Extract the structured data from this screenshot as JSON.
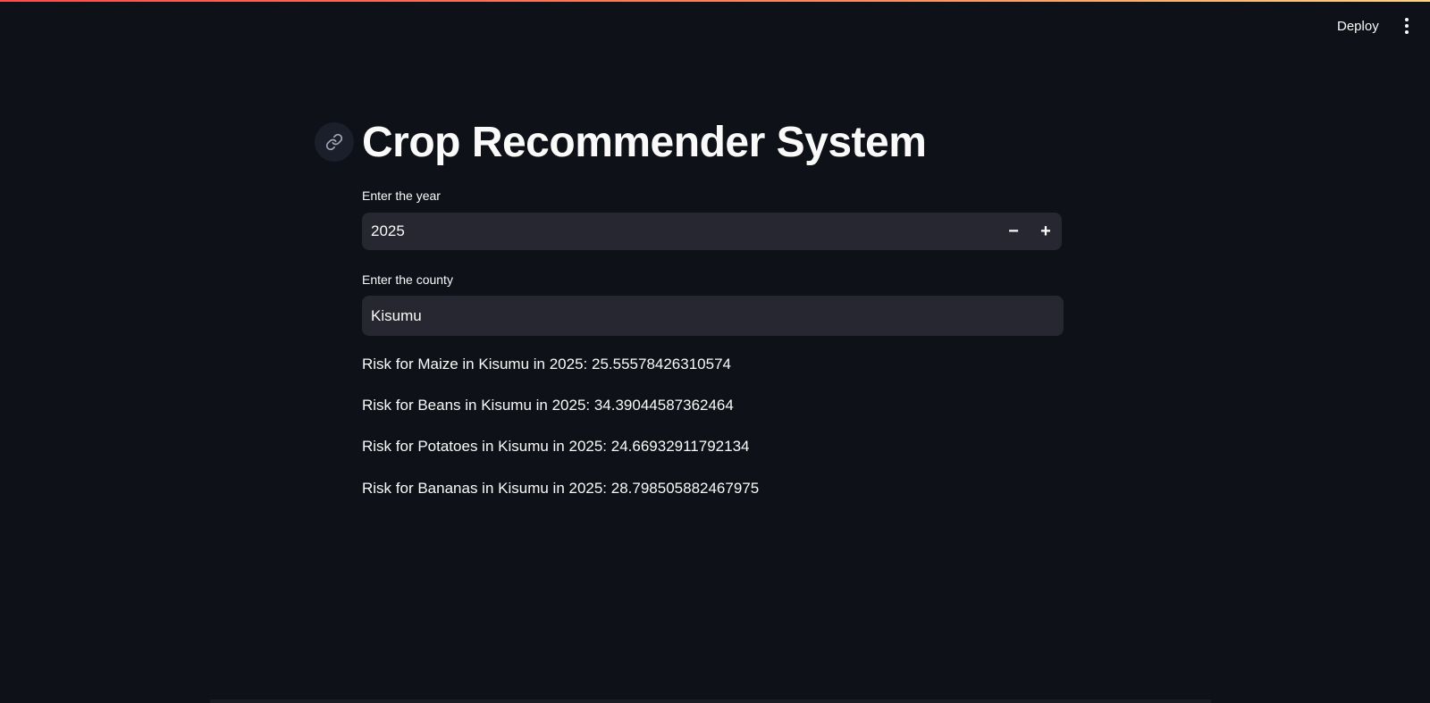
{
  "header": {
    "deploy_label": "Deploy",
    "menu_icon": "vertical-ellipsis-icon"
  },
  "main": {
    "anchor_icon": "link-icon",
    "title": "Crop Recommender System",
    "year_input": {
      "label": "Enter the year",
      "value": "2025",
      "decrement_label": "−",
      "increment_label": "+"
    },
    "county_input": {
      "label": "Enter the county",
      "value": "Kisumu"
    },
    "results": [
      "Risk for Maize in Kisumu in 2025: 25.55578426310574",
      "Risk for Beans in Kisumu in 2025: 34.39044587362464",
      "Risk for Potatoes in Kisumu in 2025: 24.66932911792134",
      "Risk for Bananas in Kisumu in 2025: 28.798505882467975"
    ]
  },
  "colors": {
    "background": "#0e1117",
    "input_background": "#262730",
    "text": "#fafafa",
    "accent_gradient_start": "#ff4b4b",
    "accent_gradient_end": "#ffd27d"
  }
}
